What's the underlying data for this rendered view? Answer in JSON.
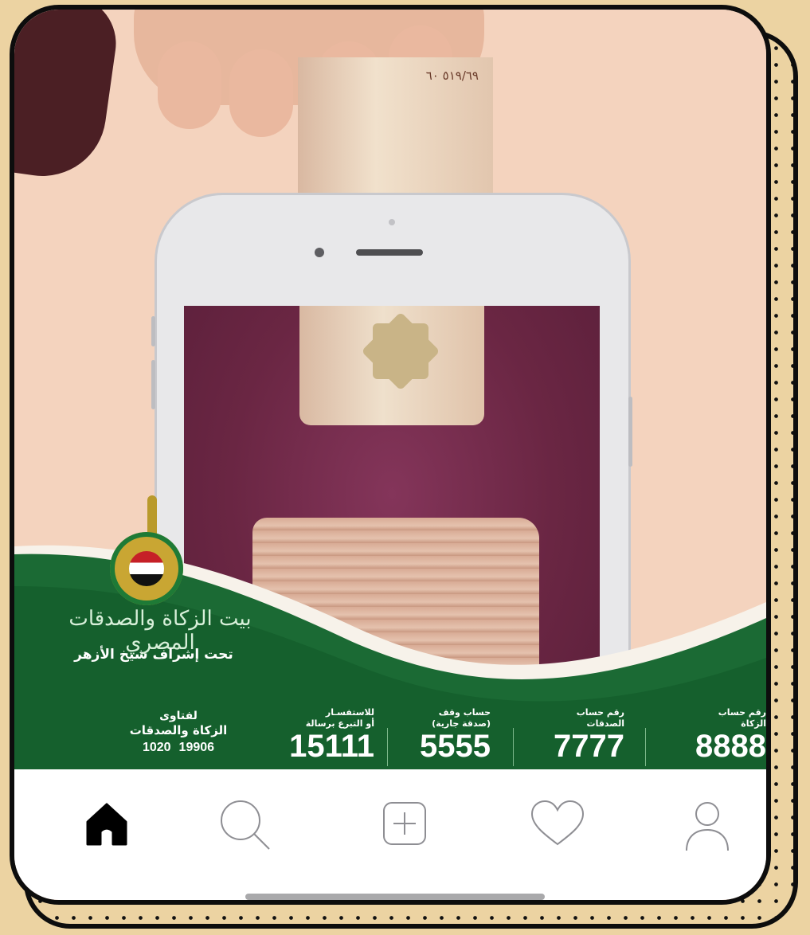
{
  "post": {
    "banknote_serial": "٥١٩/٦٩ ٦٠",
    "organization_name": "بيت الزكاة والصدقات المصري",
    "organization_subtitle": "تحت إشراف شيخ الأزهر",
    "fatwa": {
      "title": "لفتاوى",
      "subtitle": "الزكاة والصدقات",
      "numbers": [
        "1020",
        "19906"
      ]
    },
    "accounts": [
      {
        "caption_line1": "للاستفسـار",
        "caption_line2": "أو التبرع برسالة",
        "number": "15111"
      },
      {
        "caption_line1": "حساب وقف",
        "caption_line2": "(صدقة جارية)",
        "number": "5555"
      },
      {
        "caption_line1": "رقم حساب",
        "caption_line2": "الصدقات",
        "number": "7777"
      },
      {
        "caption_line1": "رقم حساب",
        "caption_line2": "الزكاة",
        "number": "8888"
      }
    ]
  },
  "tab_bar": {
    "items": [
      {
        "name": "home",
        "icon": "home-icon",
        "active": true
      },
      {
        "name": "search",
        "icon": "search-icon",
        "active": false
      },
      {
        "name": "create",
        "icon": "add-square-icon",
        "active": false
      },
      {
        "name": "activity",
        "icon": "heart-icon",
        "active": false
      },
      {
        "name": "profile",
        "icon": "person-icon",
        "active": false
      }
    ]
  },
  "colors": {
    "frame_background": "#ecd3a2",
    "green_band": "#1b6a34",
    "screen_maroon": "#6d2844",
    "active_icon": "#000000",
    "inactive_icon": "#8e8e93"
  }
}
